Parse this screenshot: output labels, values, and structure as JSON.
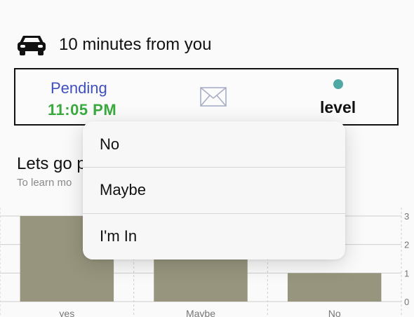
{
  "header": {
    "car_icon": "car-icon",
    "distance_text": "10 minutes from you"
  },
  "status": {
    "pending_label": "Pending",
    "time": "11:05 PM",
    "mail_icon": "envelope-icon",
    "level_label": "level",
    "dot_color": "#4fa8a4",
    "pending_color": "#3f4fbe",
    "time_color": "#3aaa3e"
  },
  "section": {
    "title": "Lets go p",
    "subtitle": "To learn mo"
  },
  "chart_data": {
    "type": "bar",
    "categories": [
      "yes",
      "Maybe",
      "No"
    ],
    "values": [
      3,
      2,
      1
    ],
    "ylim": [
      0,
      3
    ],
    "y_ticks": [
      "0",
      "1",
      "2",
      "3"
    ],
    "bar_color": "#97957d",
    "grid": true,
    "xlabel": "",
    "ylabel": ""
  },
  "menu": {
    "items": [
      {
        "label": "No"
      },
      {
        "label": "Maybe"
      },
      {
        "label": "I'm In"
      }
    ]
  }
}
